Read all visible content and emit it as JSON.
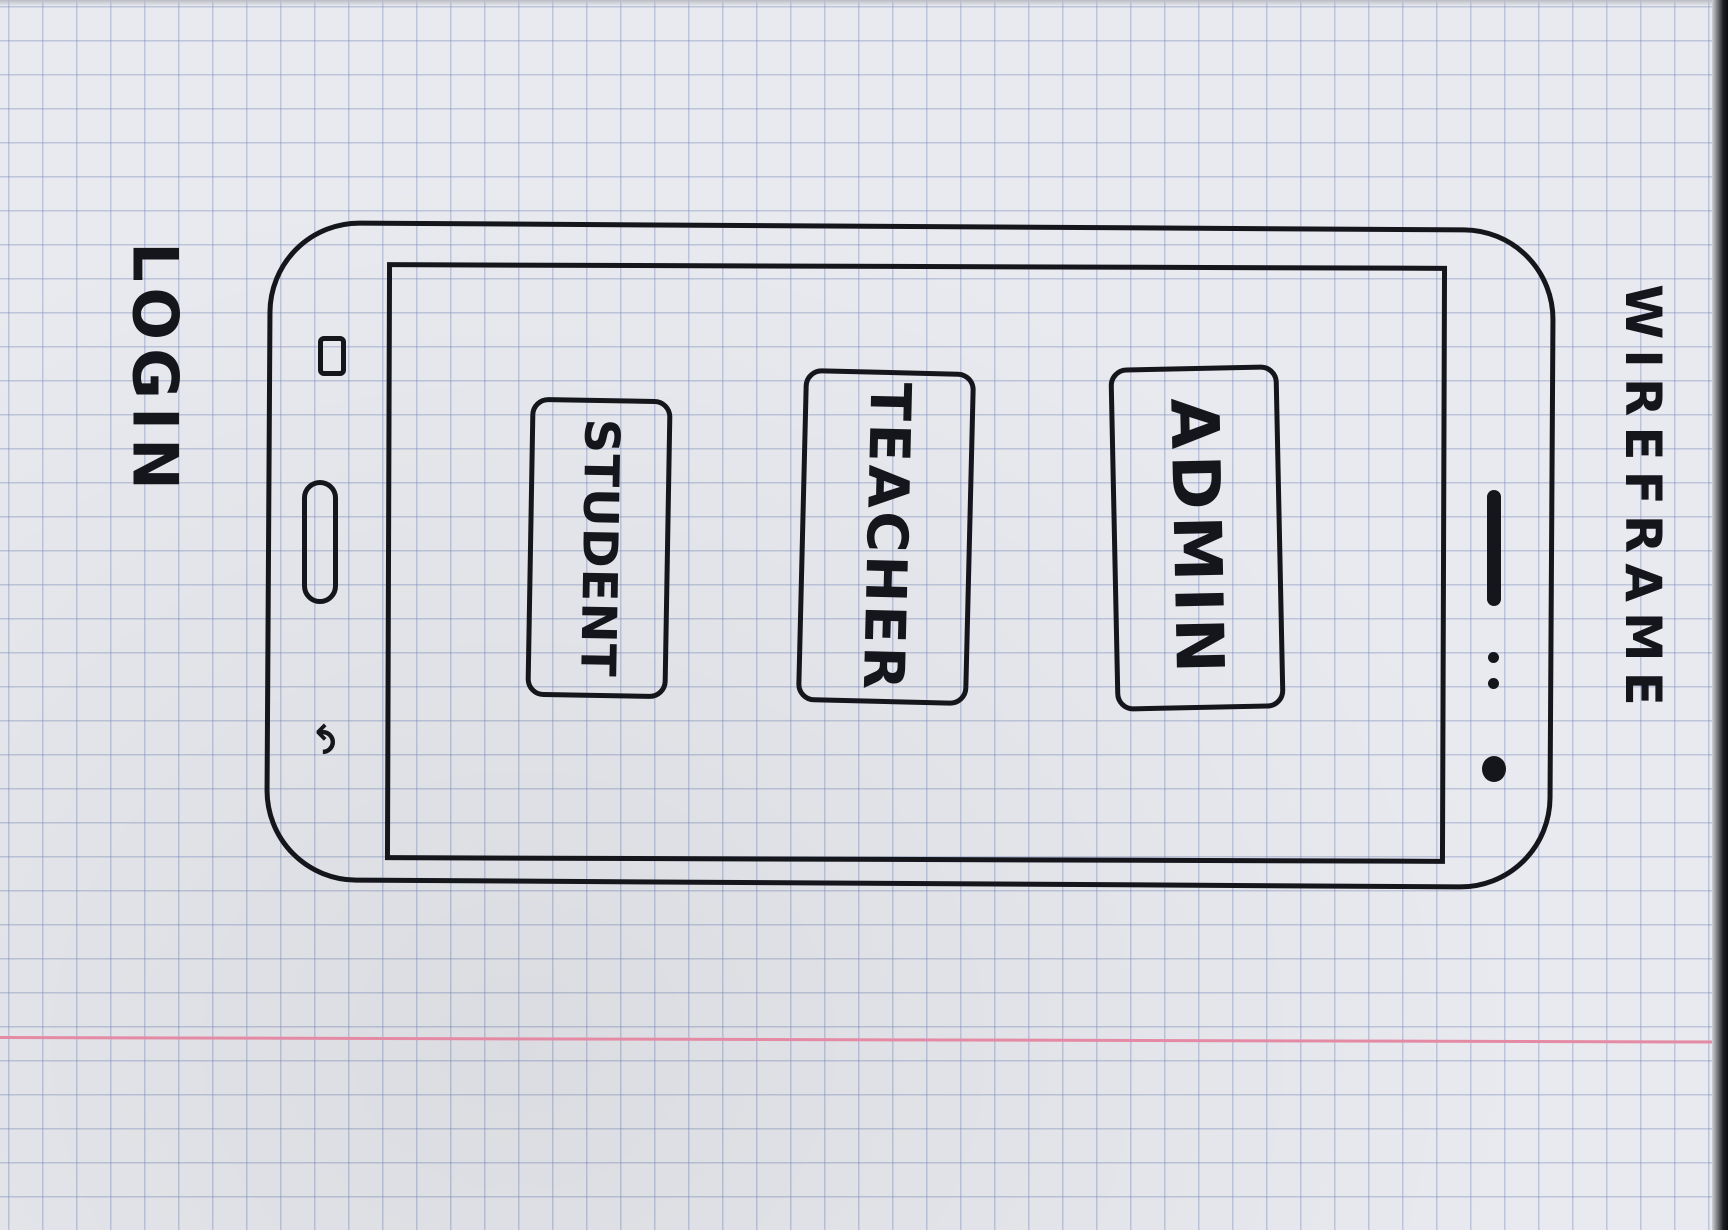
{
  "sheet": {
    "title": "WIREFRAME",
    "screen_name": "LOGIN",
    "colors": {
      "ink": "#15151c",
      "grid": "#7887b9",
      "margin_line": "#e58aa5",
      "paper": "#e8eaef"
    }
  },
  "phone": {
    "buttons": [
      {
        "label": "ADMIN"
      },
      {
        "label": "TEACHER"
      },
      {
        "label": "STUDENT"
      }
    ],
    "icons": {
      "home": "home-button-icon",
      "menu": "menu-key-icon",
      "back": "back-arrow-icon",
      "speaker": "speaker-icon",
      "camera": "front-camera-icon",
      "back_glyph": "↶"
    }
  }
}
